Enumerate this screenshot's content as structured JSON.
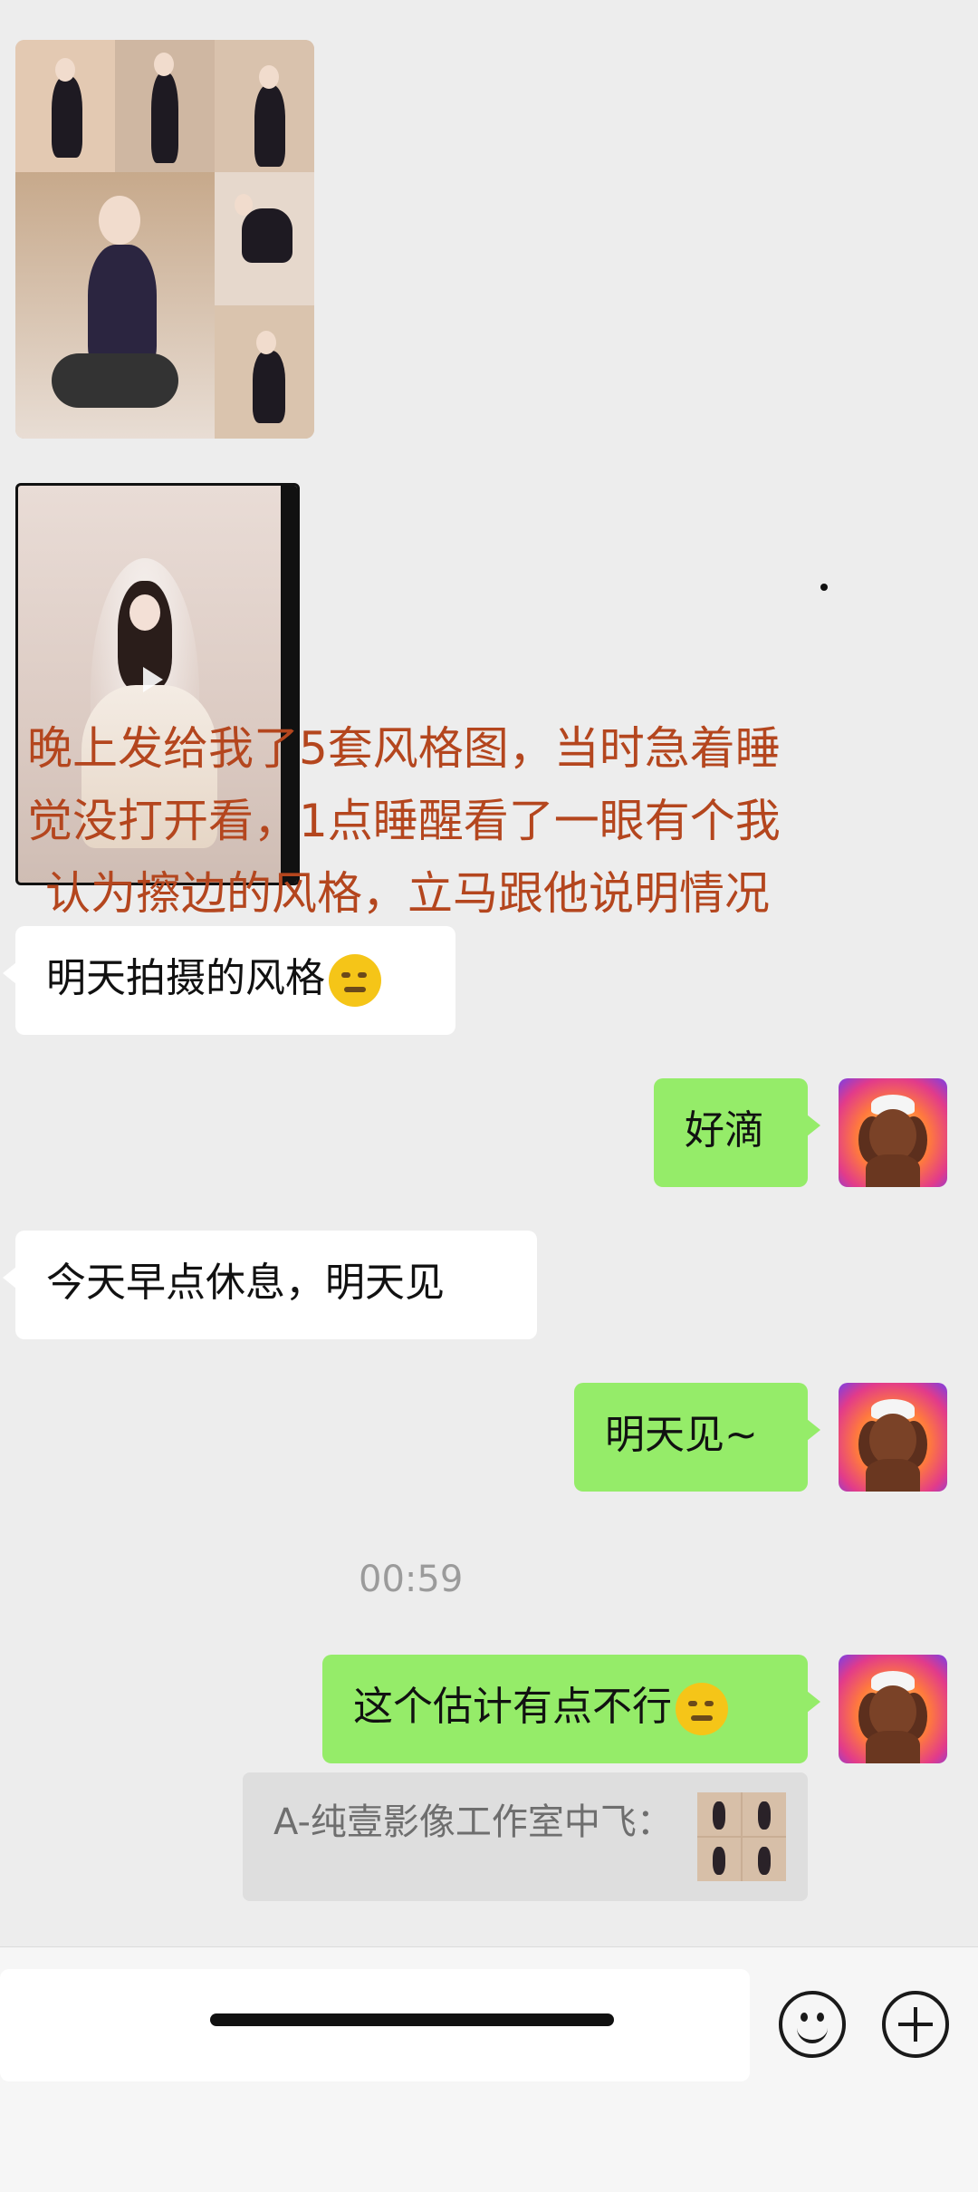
{
  "overlay_annotation": {
    "line1": "晚上发给我了5套风格图，当时急着睡",
    "line2": "觉没打开看，1点睡醒看了一眼有个我",
    "line3": "认为擦边的风格，立马跟他说明情况"
  },
  "messages": [
    {
      "side": "left",
      "text": "明天拍摄的风格",
      "emoji": "thinking-face-icon"
    },
    {
      "side": "right",
      "text": "好滴"
    },
    {
      "side": "left",
      "text": "今天早点休息，明天见"
    },
    {
      "side": "right",
      "text": "明天见~"
    },
    {
      "side": "right",
      "text": "这个估计有点不行",
      "emoji": "face-with-tears-of-joy-icon"
    }
  ],
  "timestamp": "00:59",
  "quote": {
    "text": "A-纯壹影像工作室中飞："
  },
  "colors": {
    "background": "#ededed",
    "sent_bubble": "#95ec69",
    "received_bubble": "#ffffff",
    "annotation": "#b4461e"
  }
}
